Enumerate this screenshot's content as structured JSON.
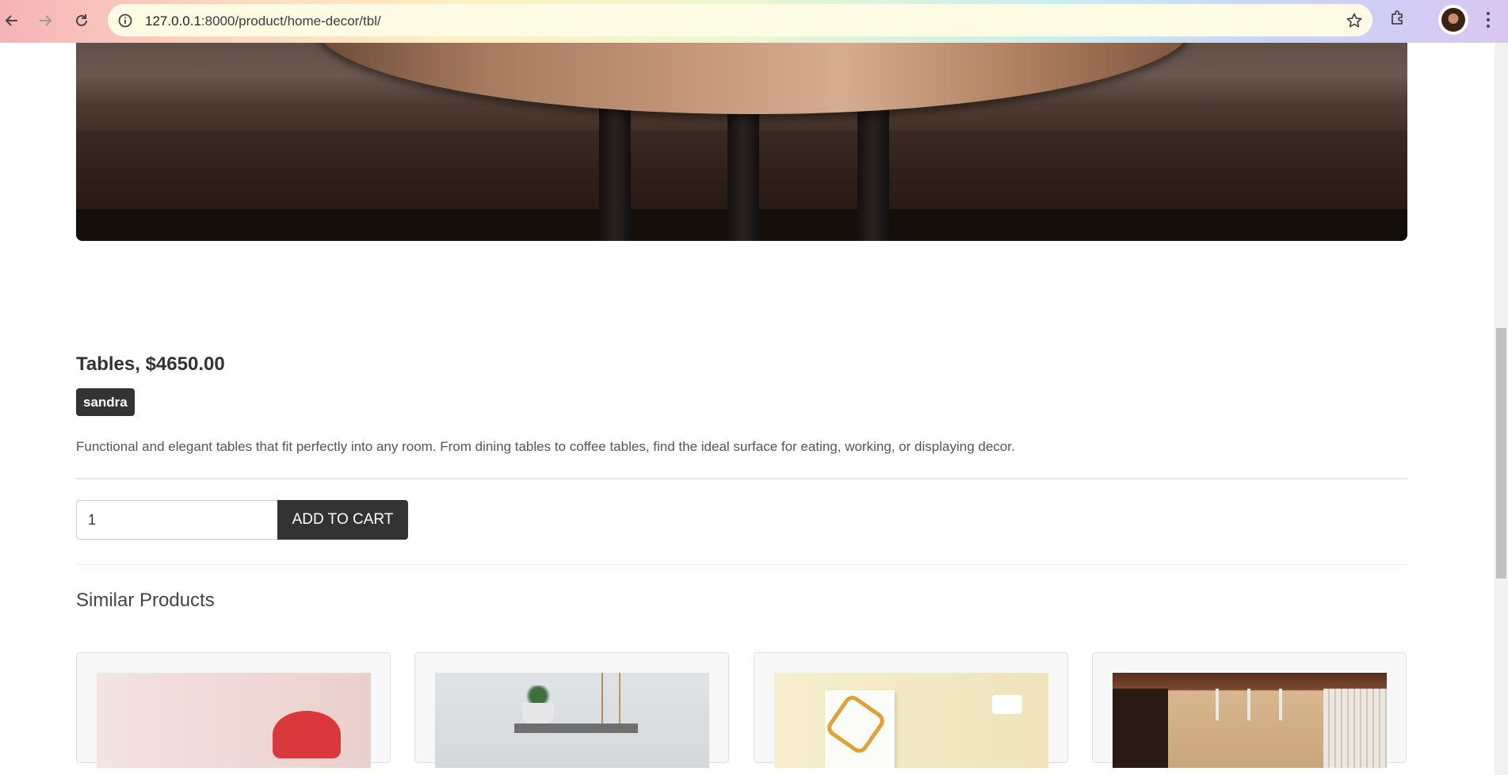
{
  "browser": {
    "url_host": "127.0.0.1",
    "url_path": ":8000/product/home-decor/tbl/",
    "back_icon": "arrow-left-icon",
    "forward_icon": "arrow-right-icon",
    "reload_icon": "reload-icon",
    "site_info_icon": "info-icon",
    "bookmark_icon": "star-icon",
    "extensions_icon": "puzzle-icon",
    "menu_icon": "kebab-menu-icon"
  },
  "product": {
    "title": "Tables, $4650.00",
    "seller": "sandra",
    "description": "Functional and elegant tables that fit perfectly into any room. From dining tables to coffee tables, find the ideal surface for eating, working, or displaying decor."
  },
  "cart": {
    "quantity": "1",
    "add_label": "ADD TO CART"
  },
  "similar": {
    "title": "Similar Products",
    "cards": [
      {
        "image": "red-chair"
      },
      {
        "image": "shelf-with-plant"
      },
      {
        "image": "wall-art"
      },
      {
        "image": "room-interior"
      }
    ]
  }
}
